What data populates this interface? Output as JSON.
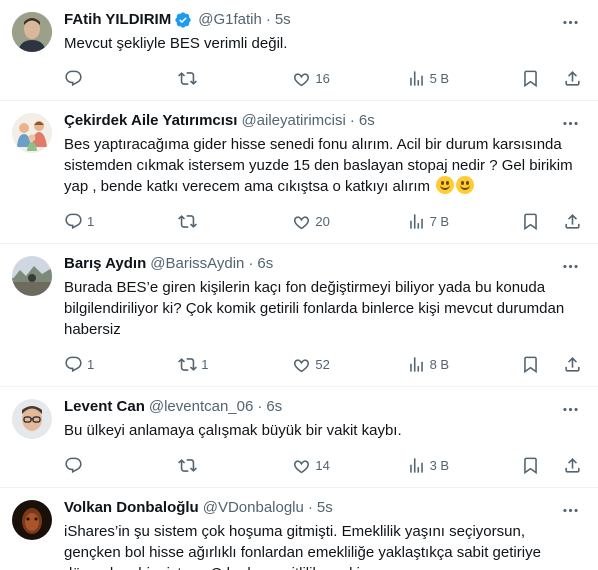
{
  "colors": {
    "accent": "#1d9bf0",
    "muted": "#536471",
    "text": "#0f1419",
    "border": "#eff3f4"
  },
  "tweets": [
    {
      "name": "FAtih YILDIRIM",
      "verified": true,
      "handle": "@G1fatih",
      "dot": "·",
      "time": "5s",
      "text": "Mevcut şekliyle BES verimli değil.",
      "replies": "",
      "retweets": "",
      "likes": "16",
      "views": "5 B",
      "avatar_icon": "avatar-photo"
    },
    {
      "name": "Çekirdek Aile Yatırımcısı",
      "verified": false,
      "handle": "@aileyatirimcisi",
      "dot": "·",
      "time": "6s",
      "text": "Bes yaptıracağıma gider hisse senedi fonu alırım. Acil bir durum karsısında sistemden cıkmak istersem yuzde 15 den baslayan stopaj nedir ? Gel birikim yap , bende katkı verecem ama cıkıştsa o katkıyı alırım",
      "emoji_icons": [
        "slightly-smiling-face-icon",
        "slightly-smiling-face-icon"
      ],
      "replies": "1",
      "retweets": "",
      "likes": "20",
      "views": "7 B",
      "avatar_icon": "family-cartoon-avatar"
    },
    {
      "name": "Barış Aydın",
      "verified": false,
      "handle": "@BarissAydin",
      "dot": "·",
      "time": "6s",
      "text": "Burada BES’e giren kişilerin kaçı fon değiştirmeyi biliyor yada bu konuda bilgilendiriliyor ki? Çok komik getirili fonlarda binlerce kişi mevcut durumdan habersiz",
      "replies": "1",
      "retweets": "1",
      "likes": "52",
      "views": "8 B",
      "avatar_icon": "landscape-avatar"
    },
    {
      "name": "Levent Can",
      "verified": false,
      "handle": "@leventcan_06",
      "dot": "·",
      "time": "6s",
      "text": "Bu ülkeyi anlamaya çalışmak büyük bir vakit kaybı.",
      "replies": "",
      "retweets": "",
      "likes": "14",
      "views": "3 B",
      "avatar_icon": "person-glasses-avatar"
    },
    {
      "name": "Volkan Donbaloğlu",
      "verified": false,
      "handle": "@VDonbaloglu",
      "dot": "·",
      "time": "5s",
      "text": "iShares’in şu sistem çok hoşuma gitmişti. Emeklilik yaşını seçiyorsun, gençken bol hisse ağırlıklı fonlardan emekliliğe yaklaştıkça sabit getiriye dönen hoş bir sistem. O kadar çeşitlilik var ki, muazzam",
      "avatar_icon": "dark-portrait-avatar"
    }
  ]
}
